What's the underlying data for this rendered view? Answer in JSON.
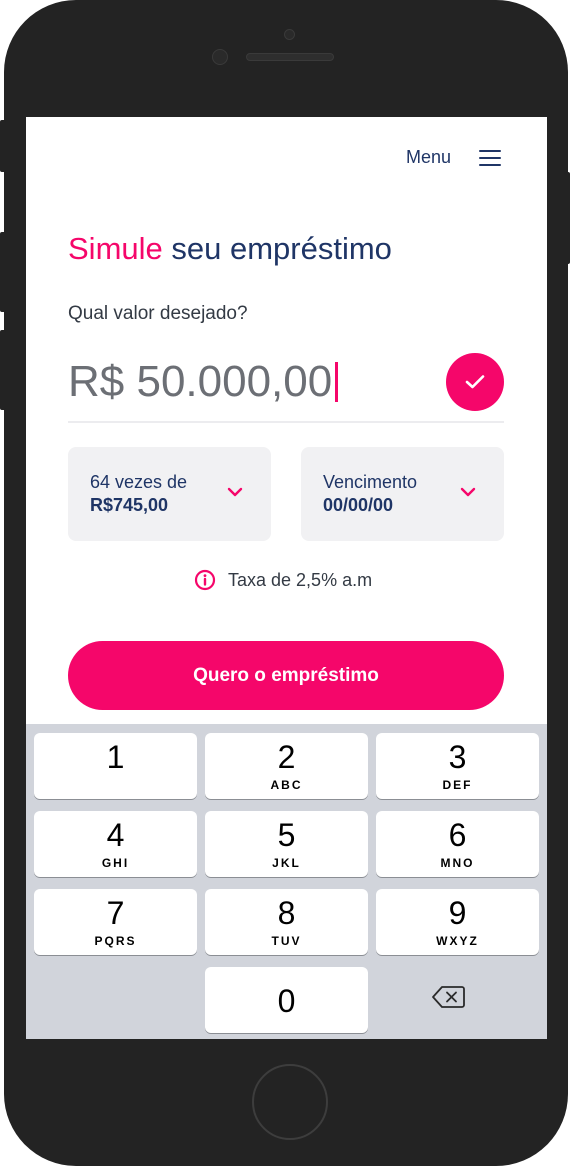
{
  "header": {
    "menu_label": "Menu"
  },
  "title": {
    "accent": "Simule",
    "rest": " seu empréstimo"
  },
  "question": "Qual valor desejado?",
  "amount": {
    "value": "R$ 50.000,00"
  },
  "installments": {
    "label": "64 vezes de",
    "value": "R$745,00"
  },
  "due_date": {
    "label": "Vencimento",
    "value": "00/00/00"
  },
  "rate": {
    "text": "Taxa de 2,5% a.m"
  },
  "cta": {
    "label": "Quero o empréstimo"
  },
  "keypad": {
    "keys": [
      {
        "num": "1",
        "letters": ""
      },
      {
        "num": "2",
        "letters": "ABC"
      },
      {
        "num": "3",
        "letters": "DEF"
      },
      {
        "num": "4",
        "letters": "GHI"
      },
      {
        "num": "5",
        "letters": "JKL"
      },
      {
        "num": "6",
        "letters": "MNO"
      },
      {
        "num": "7",
        "letters": "PQRS"
      },
      {
        "num": "8",
        "letters": "TUV"
      },
      {
        "num": "9",
        "letters": "WXYZ"
      },
      {
        "num": "0",
        "letters": ""
      }
    ]
  },
  "colors": {
    "accent": "#f5066a",
    "navy": "#1f3566",
    "keypad_bg": "#d1d4db",
    "selector_bg": "#f1f1f3"
  }
}
